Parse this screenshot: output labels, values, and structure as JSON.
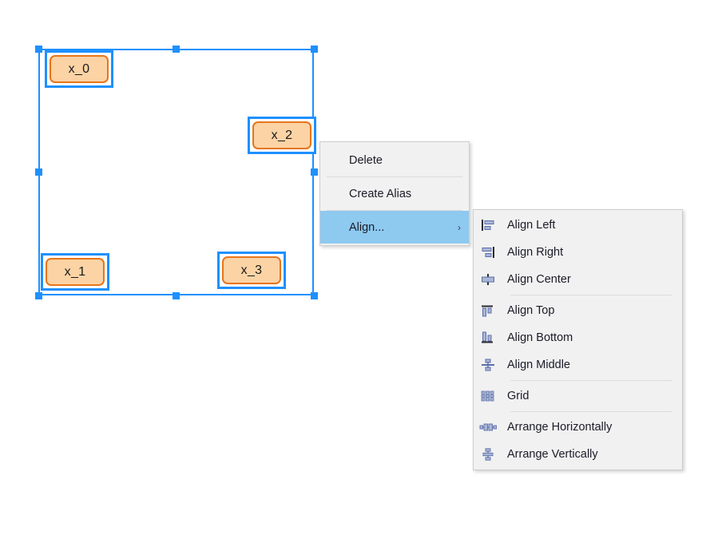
{
  "canvas": {
    "selection": {
      "label": "multi-selection-bounds",
      "handle_color": "#1e90ff"
    },
    "nodes": [
      {
        "id": "x_0",
        "label": "x_0"
      },
      {
        "id": "x_2",
        "label": "x_2"
      },
      {
        "id": "x_1",
        "label": "x_1"
      },
      {
        "id": "x_3",
        "label": "x_3"
      }
    ]
  },
  "context_menu": {
    "items": [
      {
        "label": "Delete",
        "has_submenu": false,
        "highlighted": false
      },
      {
        "label": "Create Alias",
        "has_submenu": false,
        "highlighted": false
      },
      {
        "label": "Align...",
        "has_submenu": true,
        "highlighted": true,
        "arrow": "›"
      }
    ]
  },
  "align_submenu": {
    "items": [
      {
        "label": "Align Left",
        "icon": "align-left-icon"
      },
      {
        "label": "Align Right",
        "icon": "align-right-icon"
      },
      {
        "label": "Align Center",
        "icon": "align-center-icon"
      },
      {
        "separator_after": true
      },
      {
        "label": "Align Top",
        "icon": "align-top-icon"
      },
      {
        "label": "Align Bottom",
        "icon": "align-bottom-icon"
      },
      {
        "label": "Align Middle",
        "icon": "align-middle-icon"
      },
      {
        "separator_after": true
      },
      {
        "label": "Grid",
        "icon": "grid-icon"
      },
      {
        "separator_after": true
      },
      {
        "label": "Arrange Horizontally",
        "icon": "arrange-horizontally-icon"
      },
      {
        "label": "Arrange Vertically",
        "icon": "arrange-vertically-icon"
      }
    ]
  },
  "colors": {
    "selection_blue": "#1e90ff",
    "node_fill": "#fbd3a5",
    "node_border": "#e8751a",
    "menu_bg": "#f1f1f1",
    "highlight_blue": "#8ec9f0",
    "icon_blue": "#5b6ea8"
  }
}
